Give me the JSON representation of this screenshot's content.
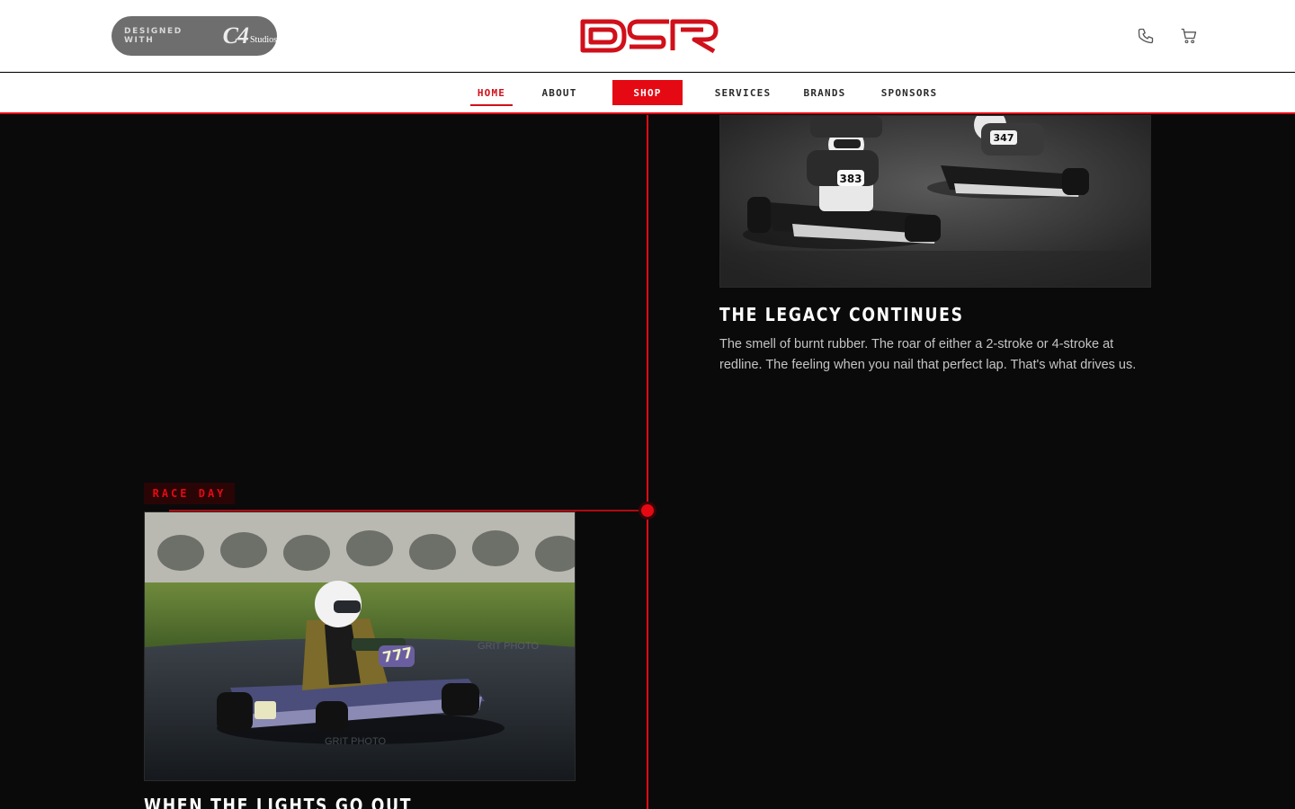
{
  "header": {
    "designed_small": "DESIGNED WITH",
    "designed_brand": "C4",
    "designed_studios": "Studios",
    "logo_text": "DSR",
    "icons": [
      "phone-icon",
      "cart-icon"
    ]
  },
  "nav": {
    "items": [
      {
        "label": "HOME",
        "state": "active"
      },
      {
        "label": "ABOUT"
      },
      {
        "label": "SHOP",
        "state": "highlighted"
      },
      {
        "label": "SERVICES"
      },
      {
        "label": "BRANDS"
      },
      {
        "label": "SPONSORS"
      }
    ]
  },
  "timeline": {
    "right_card": {
      "title": "THE LEGACY CONTINUES",
      "description": "The smell of burnt rubber. The roar of either a 2-stroke or 4-stroke at redline. The feeling when you nail that perfect lap. That's what drives us.",
      "kart_numbers": [
        "383",
        "347"
      ]
    },
    "left_card": {
      "tag": "RACE DAY",
      "title": "WHEN THE LIGHTS GO OUT",
      "kart_number": "777",
      "watermark": "GRIT PHOTO"
    }
  },
  "colors": {
    "accent": "#e50914",
    "background": "#0a0a0b",
    "white": "#ffffff"
  }
}
